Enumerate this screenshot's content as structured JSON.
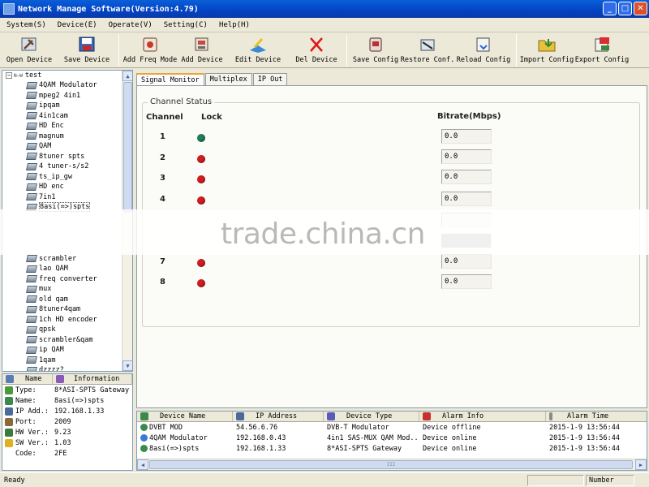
{
  "window": {
    "title": "Network Manage Software(Version:4.79)"
  },
  "menu": [
    "System(S)",
    "Device(E)",
    "Operate(V)",
    "Setting(C)",
    "Help(H)"
  ],
  "toolbar": {
    "open_device": "Open Device",
    "save_device": "Save Device",
    "add_freq_mode": "Add Freq Mode",
    "add_device": "Add Device",
    "edit_device": "Edit Device",
    "del_device": "Del Device",
    "save_config": "Save Config",
    "restore_conf": "Restore Conf.",
    "reload_config": "Reload Config",
    "import_config": "Import Config",
    "export_config": "Export Config"
  },
  "tree": {
    "root": "test",
    "items_top": [
      "4QAM Modulator",
      "mpeg2 4in1",
      "ipqam",
      "4in1cam",
      "HD Enc",
      "magnum",
      "QAM",
      "8tuner spts",
      "4 tuner-s/s2",
      "ts_ip_gw",
      "HD enc",
      "7in1",
      "8asi(=>)spts"
    ],
    "items_bottom": [
      "scrambler",
      "lao QAM",
      "freq converter",
      "mux",
      "old qam",
      "8tuner4qam",
      "1ch HD encoder",
      "qpsk",
      "scrambler&qam",
      "ip QAM",
      "1qam",
      "dzzzz?"
    ]
  },
  "info": {
    "headers": [
      "Name",
      "Information"
    ],
    "rows": [
      {
        "key": "Type:",
        "value": "8*ASI-SPTS Gateway",
        "icon_color": "#4a9a3a"
      },
      {
        "key": "Name:",
        "value": "8asi(=>)spts",
        "icon_color": "#3a8a4a"
      },
      {
        "key": "IP Add.:",
        "value": "192.168.1.33",
        "icon_color": "#4a6a9a"
      },
      {
        "key": "Port:",
        "value": "2009",
        "icon_color": "#8a6a3a"
      },
      {
        "key": "HW Ver.:",
        "value": "9.23",
        "icon_color": "#3a7a3a"
      },
      {
        "key": "SW Ver.:",
        "value": "1.03",
        "icon_color": "#e0b020"
      },
      {
        "key": "Code:",
        "value": "2FE",
        "icon_color": ""
      }
    ]
  },
  "tabs": [
    "Signal Monitor",
    "Multiplex",
    "IP Out"
  ],
  "channel_status": {
    "title": "Channel Status",
    "col_channel": "Channel",
    "col_lock": "Lock",
    "col_bitrate": "Bitrate(Mbps)",
    "lock_colors": {
      "locked": "#1e7f5a",
      "unlocked": "#d31c1c"
    },
    "channels": [
      {
        "ch": "1",
        "locked": true,
        "bitrate": "0.0"
      },
      {
        "ch": "2",
        "locked": false,
        "bitrate": "0.0"
      },
      {
        "ch": "3",
        "locked": false,
        "bitrate": "0.0"
      },
      {
        "ch": "4",
        "locked": false,
        "bitrate": "0.0"
      },
      {
        "ch": "7",
        "locked": false,
        "bitrate": "0.0"
      },
      {
        "ch": "8",
        "locked": false,
        "bitrate": "0.0"
      }
    ]
  },
  "watermark": "trade.china.cn",
  "device_table": {
    "headers": [
      "Device Name",
      "IP Address",
      "Device Type",
      "Alarm Info",
      "Alarm Time"
    ],
    "rows": [
      [
        "DVBT MOD",
        "54.56.6.76",
        "DVB-T Modulator",
        "Device offline",
        "2015-1-9 13:56:44"
      ],
      [
        "4QAM Modulator",
        "192.168.0.43",
        "4in1 SAS-MUX QAM Mod...",
        "Device online",
        "2015-1-9 13:56:44"
      ],
      [
        "8asi(=>)spts",
        "192.168.1.33",
        "8*ASI-SPTS Gateway",
        "Device online",
        "2015-1-9 13:56:44"
      ]
    ],
    "scroll_glyph": "III"
  },
  "status": {
    "text": "Ready",
    "number": "Number"
  }
}
